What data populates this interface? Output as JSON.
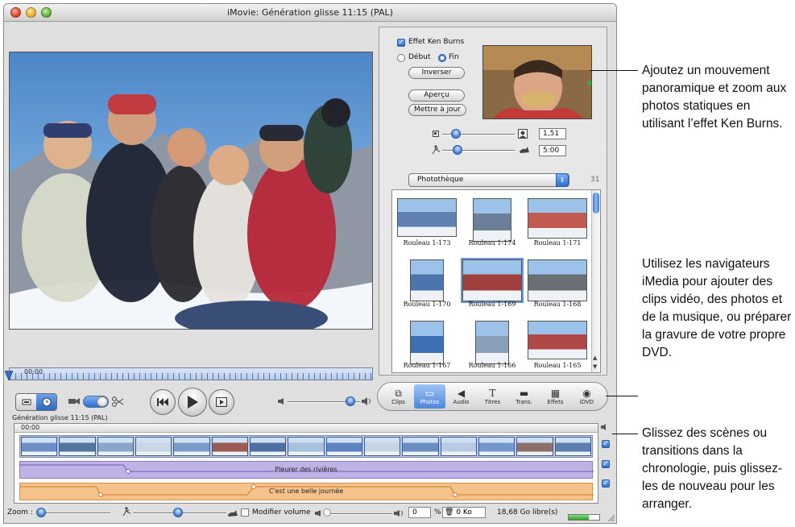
{
  "window": {
    "title": "iMovie: Génération glisse   11:15 (PAL)"
  },
  "viewer": {
    "timecode": "00:00"
  },
  "ken_burns": {
    "checkbox_label": "Effet Ken Burns",
    "start_label": "Début",
    "end_label": "Fin",
    "reverse_button": "Inverser",
    "preview_button": "Aperçu",
    "update_button": "Mettre à jour",
    "zoom_value": "1,51",
    "duration_value": "5:00"
  },
  "media_browser": {
    "source": "Photothèque",
    "count": "31",
    "photos": [
      {
        "label": "Rouleau 1-173"
      },
      {
        "label": "Rouleau 1-174"
      },
      {
        "label": "Rouleau 1-171"
      },
      {
        "label": "Rouleau 1-170"
      },
      {
        "label": "Rouleau 1-169"
      },
      {
        "label": "Rouleau 1-168"
      },
      {
        "label": "Rouleau 1-167"
      },
      {
        "label": "Rouleau 1-166"
      },
      {
        "label": "Rouleau 1-165"
      }
    ]
  },
  "tabs": [
    {
      "label": "Clips",
      "icon": "clips-icon"
    },
    {
      "label": "Photos",
      "icon": "photos-icon"
    },
    {
      "label": "Audio",
      "icon": "audio-icon"
    },
    {
      "label": "Titres",
      "icon": "titles-icon"
    },
    {
      "label": "Trans.",
      "icon": "transitions-icon"
    },
    {
      "label": "Effets",
      "icon": "effects-icon"
    },
    {
      "label": "iDVD",
      "icon": "idvd-icon"
    }
  ],
  "timeline": {
    "title": "Génération glisse  11:15 (PAL)",
    "timecode": "00:00",
    "audio_track_1": "Pleurer des rivières",
    "audio_track_2": "C'est une belle journée"
  },
  "bottom_bar": {
    "zoom_label": "Zoom :",
    "modify_volume": "Modifier volume",
    "volume_value": "0",
    "volume_unit": "%",
    "trash_value": "0 Ko",
    "free_space": "18,68 Go libre(s)",
    "free_space_fill": 0.65
  },
  "callouts": {
    "ken_burns": "Ajoutez un mouvement panoramique et zoom aux photos statiques en utilisant l’effet Ken Burns.",
    "imedia": "Utilisez les navigateurs iMedia pour ajouter des clips vidéo, des photos et de la musique, ou préparer la gravure de votre propre DVD.",
    "timeline": "Glissez des scènes ou transitions dans la chronologie, puis glissez-les de nouveau pour les arranger."
  }
}
